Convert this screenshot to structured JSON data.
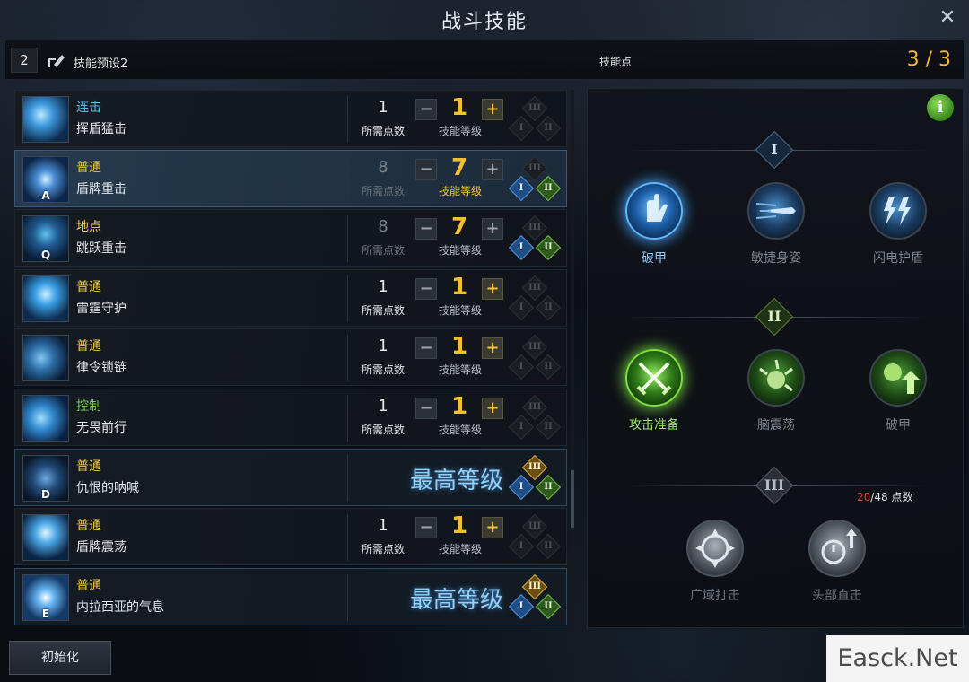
{
  "window": {
    "title": "战斗技能",
    "close_glyph": "✕"
  },
  "header": {
    "preset_number": "2",
    "preset_name": "技能预设2",
    "skill_points_label": "技能点",
    "skill_points_value": "3 / 3"
  },
  "skills": [
    {
      "type": "连击",
      "type_color": "#4fc3e8",
      "name": "挥盾猛击",
      "key": "",
      "required": "1",
      "required_label": "所需点数",
      "level": "1",
      "level_label": "技能等级",
      "maxed": false,
      "selected": false,
      "tiers": {
        "t1": "I",
        "t2": "II",
        "t3": "III",
        "t1_state": "off",
        "t2_state": "off",
        "t3_state": "off"
      }
    },
    {
      "type": "普通",
      "type_color": "#f0c84a",
      "name": "盾牌重击",
      "key": "A",
      "required": "8",
      "required_label": "所需点数",
      "level": "7",
      "level_label": "技能等级",
      "maxed": false,
      "selected": true,
      "tiers": {
        "t1": "I",
        "t2": "II",
        "t3": "III",
        "t1_state": "blue",
        "t2_state": "green",
        "t3_state": "off"
      }
    },
    {
      "type": "地点",
      "type_color": "#f0c84a",
      "name": "跳跃重击",
      "key": "Q",
      "required": "8",
      "required_label": "所需点数",
      "level": "7",
      "level_label": "技能等级",
      "maxed": false,
      "selected": false,
      "tiers": {
        "t1": "I",
        "t2": "II",
        "t3": "III",
        "t1_state": "blue",
        "t2_state": "green",
        "t3_state": "off"
      }
    },
    {
      "type": "普通",
      "type_color": "#f0c84a",
      "name": "雷霆守护",
      "key": "",
      "required": "1",
      "required_label": "所需点数",
      "level": "1",
      "level_label": "技能等级",
      "maxed": false,
      "selected": false,
      "tiers": {
        "t1": "I",
        "t2": "II",
        "t3": "III",
        "t1_state": "off",
        "t2_state": "off",
        "t3_state": "off"
      }
    },
    {
      "type": "普通",
      "type_color": "#f0c84a",
      "name": "律令锁链",
      "key": "",
      "required": "1",
      "required_label": "所需点数",
      "level": "1",
      "level_label": "技能等级",
      "maxed": false,
      "selected": false,
      "tiers": {
        "t1": "I",
        "t2": "II",
        "t3": "III",
        "t1_state": "off",
        "t2_state": "off",
        "t3_state": "off"
      }
    },
    {
      "type": "控制",
      "type_color": "#6fd04a",
      "name": "无畏前行",
      "key": "",
      "required": "1",
      "required_label": "所需点数",
      "level": "1",
      "level_label": "技能等级",
      "maxed": false,
      "selected": false,
      "tiers": {
        "t1": "I",
        "t2": "II",
        "t3": "III",
        "t1_state": "off",
        "t2_state": "off",
        "t3_state": "off"
      }
    },
    {
      "type": "普通",
      "type_color": "#f0c84a",
      "name": "仇恨的呐喊",
      "key": "D",
      "maxed": true,
      "max_label": "最高等级",
      "selected": false,
      "tiers": {
        "t1": "I",
        "t2": "II",
        "t3": "III",
        "t1_state": "blue",
        "t2_state": "green",
        "t3_state": "gold"
      }
    },
    {
      "type": "普通",
      "type_color": "#f0c84a",
      "name": "盾牌震荡",
      "key": "",
      "required": "1",
      "required_label": "所需点数",
      "level": "1",
      "level_label": "技能等级",
      "maxed": false,
      "selected": false,
      "tiers": {
        "t1": "I",
        "t2": "II",
        "t3": "III",
        "t1_state": "off",
        "t2_state": "off",
        "t3_state": "off"
      }
    },
    {
      "type": "普通",
      "type_color": "#f0c84a",
      "name": "内拉西亚的气息",
      "key": "E",
      "maxed": true,
      "max_label": "最高等级",
      "selected": false,
      "tiers": {
        "t1": "I",
        "t2": "II",
        "t3": "III",
        "t1_state": "blue",
        "t2_state": "green",
        "t3_state": "gold"
      }
    }
  ],
  "controls": {
    "minus": "−",
    "plus": "+"
  },
  "reset_button": "初始化",
  "tripods": {
    "info_glyph": "i",
    "tier1": {
      "label": "I",
      "nodes": [
        {
          "name": "破甲",
          "state": "selected",
          "icon": "hand-shield-icon"
        },
        {
          "name": "敏捷身姿",
          "state": "available",
          "icon": "dash-blade-icon"
        },
        {
          "name": "闪电护盾",
          "state": "available",
          "icon": "lightning-icon"
        }
      ]
    },
    "tier2": {
      "label": "II",
      "nodes": [
        {
          "name": "攻击准备",
          "state": "selected",
          "icon": "crossed-swords-icon"
        },
        {
          "name": "脑震荡",
          "state": "available",
          "icon": "impact-icon"
        },
        {
          "name": "破甲",
          "state": "available",
          "icon": "orb-up-icon"
        }
      ]
    },
    "tier3": {
      "label": "III",
      "nodes": [
        {
          "name": "广域打击",
          "state": "locked",
          "icon": "compass-arrows-icon"
        },
        {
          "name": "头部直击",
          "state": "locked",
          "icon": "stopwatch-up-icon"
        }
      ]
    },
    "points_current": "20",
    "points_text": "/48 点数"
  },
  "watermark": "Easck.Net"
}
